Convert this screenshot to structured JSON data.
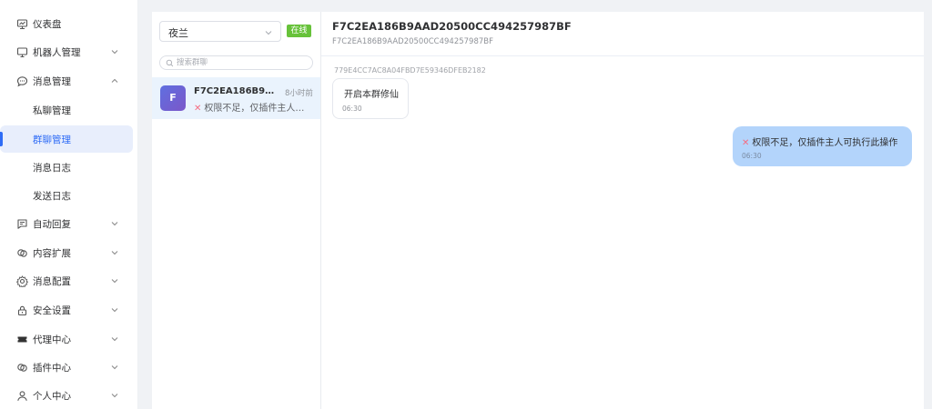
{
  "sidebar": {
    "items": [
      {
        "label": "仪表盘",
        "icon": "dashboard-icon"
      },
      {
        "label": "机器人管理",
        "icon": "monitor-icon"
      },
      {
        "label": "消息管理",
        "icon": "message-icon"
      },
      {
        "label": "私聊管理"
      },
      {
        "label": "群聊管理"
      },
      {
        "label": "消息日志"
      },
      {
        "label": "发送日志"
      },
      {
        "label": "自动回复",
        "icon": "chat-icon"
      },
      {
        "label": "内容扩展",
        "icon": "link-icon"
      },
      {
        "label": "消息配置",
        "icon": "gear-icon"
      },
      {
        "label": "安全设置",
        "icon": "lock-icon"
      },
      {
        "label": "代理中心",
        "icon": "ticket-icon"
      },
      {
        "label": "插件中心",
        "icon": "plugin-icon"
      },
      {
        "label": "个人中心",
        "icon": "user-icon"
      }
    ]
  },
  "middle": {
    "bot_select": "夜兰",
    "status_tag": "在线",
    "search_placeholder": "搜索群聊",
    "conversation": {
      "avatar_letter": "F",
      "title": "F7C2EA186B9AAD20500CC494257987BF",
      "time": "8小时前",
      "preview": "权限不足，仅插件主人可执行此操作"
    }
  },
  "chat": {
    "title": "F7C2EA186B9AAD20500CC494257987BF",
    "subtitle": "F7C2EA186B9AAD20500CC494257987BF",
    "messages": [
      {
        "sender": "779E4CC7AC8A04FBD7E59346DFEB2182",
        "text": "开启本群修仙",
        "time": "06:30"
      },
      {
        "text": "权限不足，仅插件主人可执行此操作",
        "time": "06:30"
      }
    ]
  },
  "colors": {
    "accent": "#2f6cf6",
    "online": "#67c23a",
    "outgoing_bubble": "#b3d4fb",
    "error": "#f56c82"
  }
}
